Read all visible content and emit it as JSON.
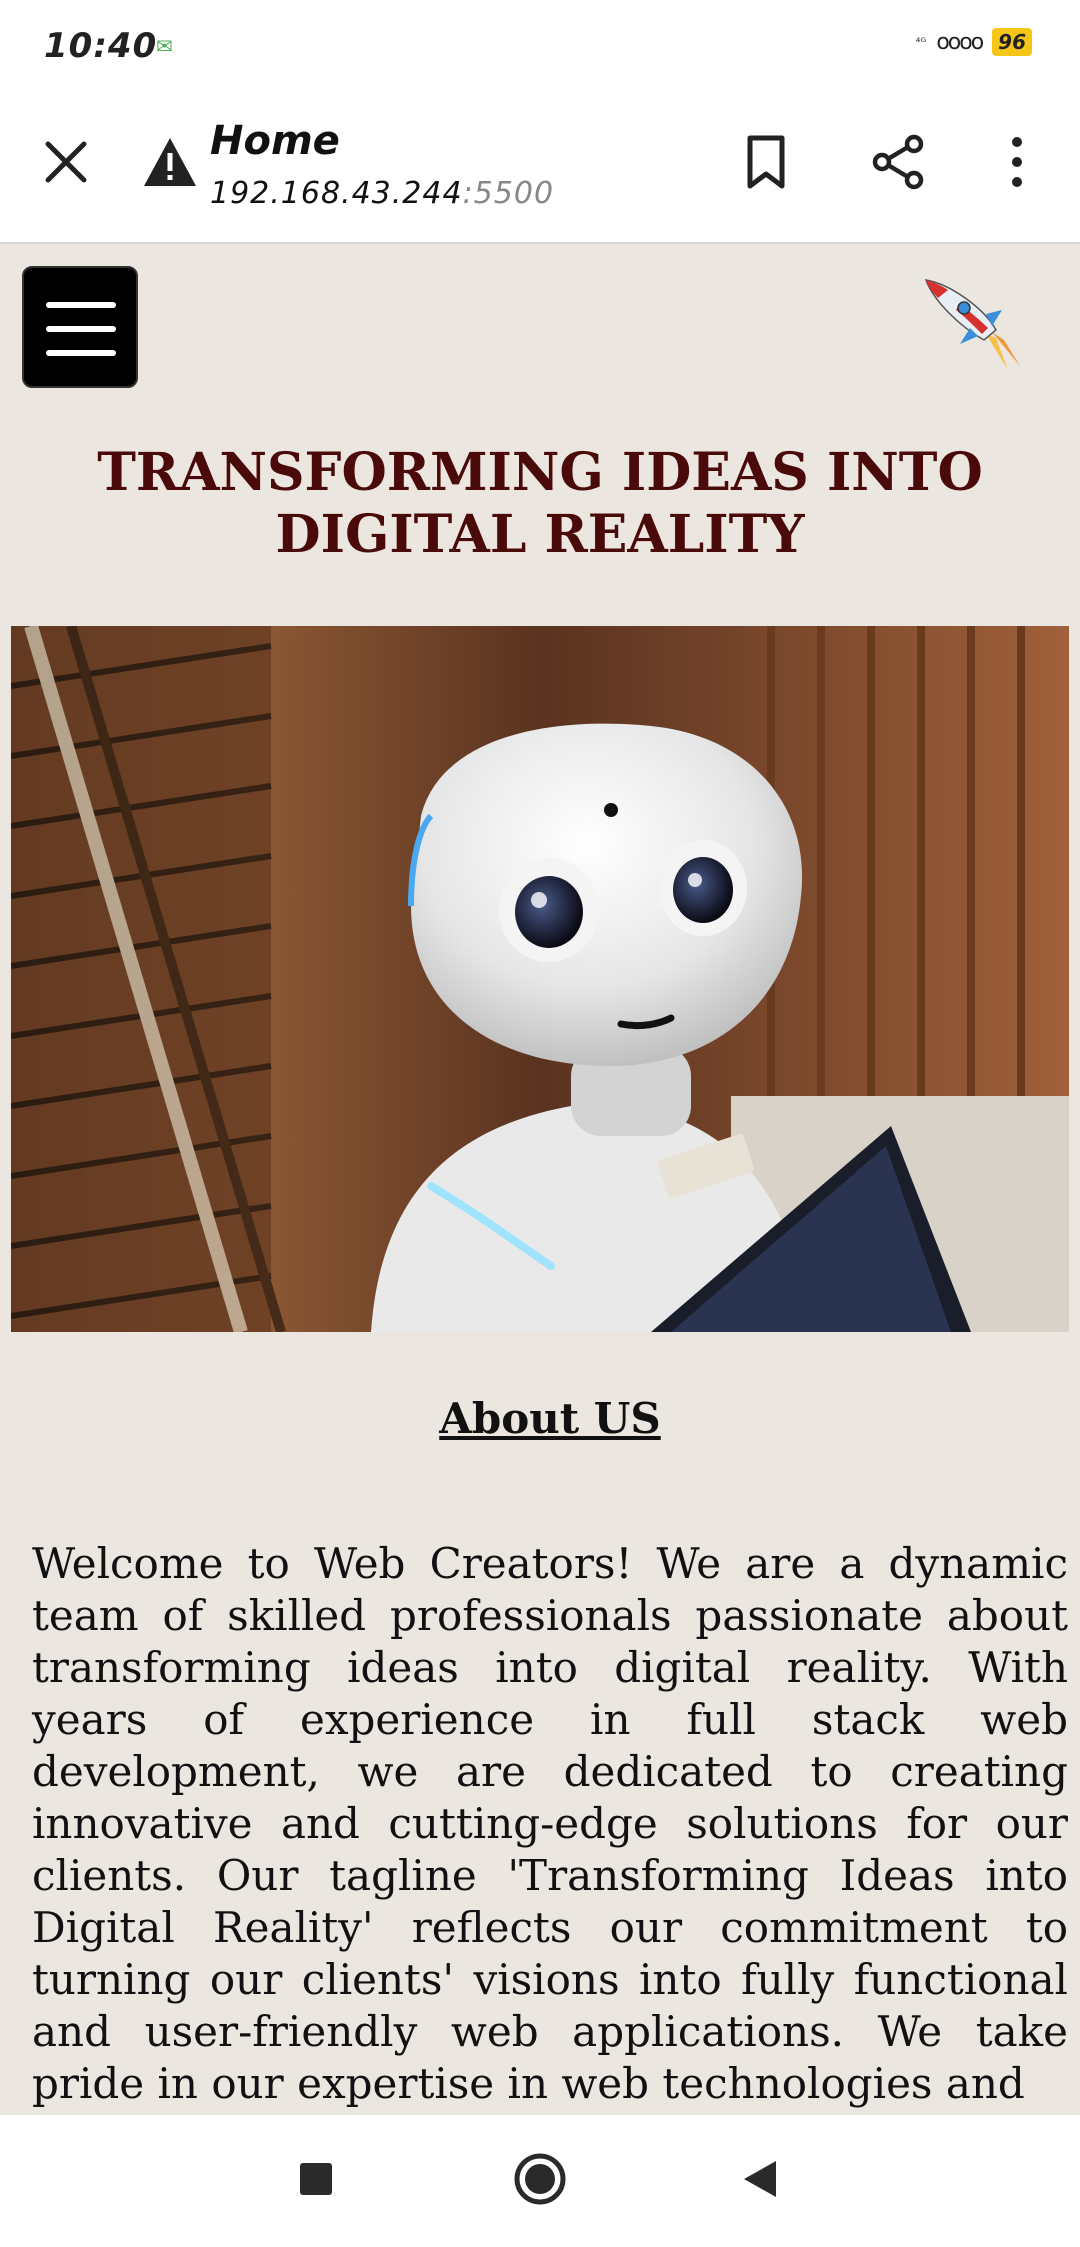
{
  "status_bar": {
    "time": "10:40",
    "indicators": "⁴ᴳ",
    "battery": "96"
  },
  "browser": {
    "title": "Home",
    "url_host": "192.168.43.244",
    "url_port": ":5500",
    "icons": [
      "close-icon",
      "warning-icon",
      "bookmark-icon",
      "share-icon",
      "more-vert-icon"
    ]
  },
  "page": {
    "headline": "TRANSFORMING IDEAS INTO DIGITAL REALITY",
    "about_heading": "About US",
    "about_paragraph": "Welcome to Web Creators! We are a dynamic team of skilled professionals passionate about transforming ideas into digital reality. With years of experience in full stack web development, we are dedicated to creating innovative and cutting-edge solutions for our clients. Our tagline 'Transforming Ideas into Digital Reality' reflects our commitment to turning our clients' visions into fully functional and user-friendly web applications. We take pride in our expertise in web technologies and"
  },
  "colors": {
    "page_background": "#ece6e1",
    "headline": "#4a0a0a",
    "battery": "#f5c518"
  }
}
